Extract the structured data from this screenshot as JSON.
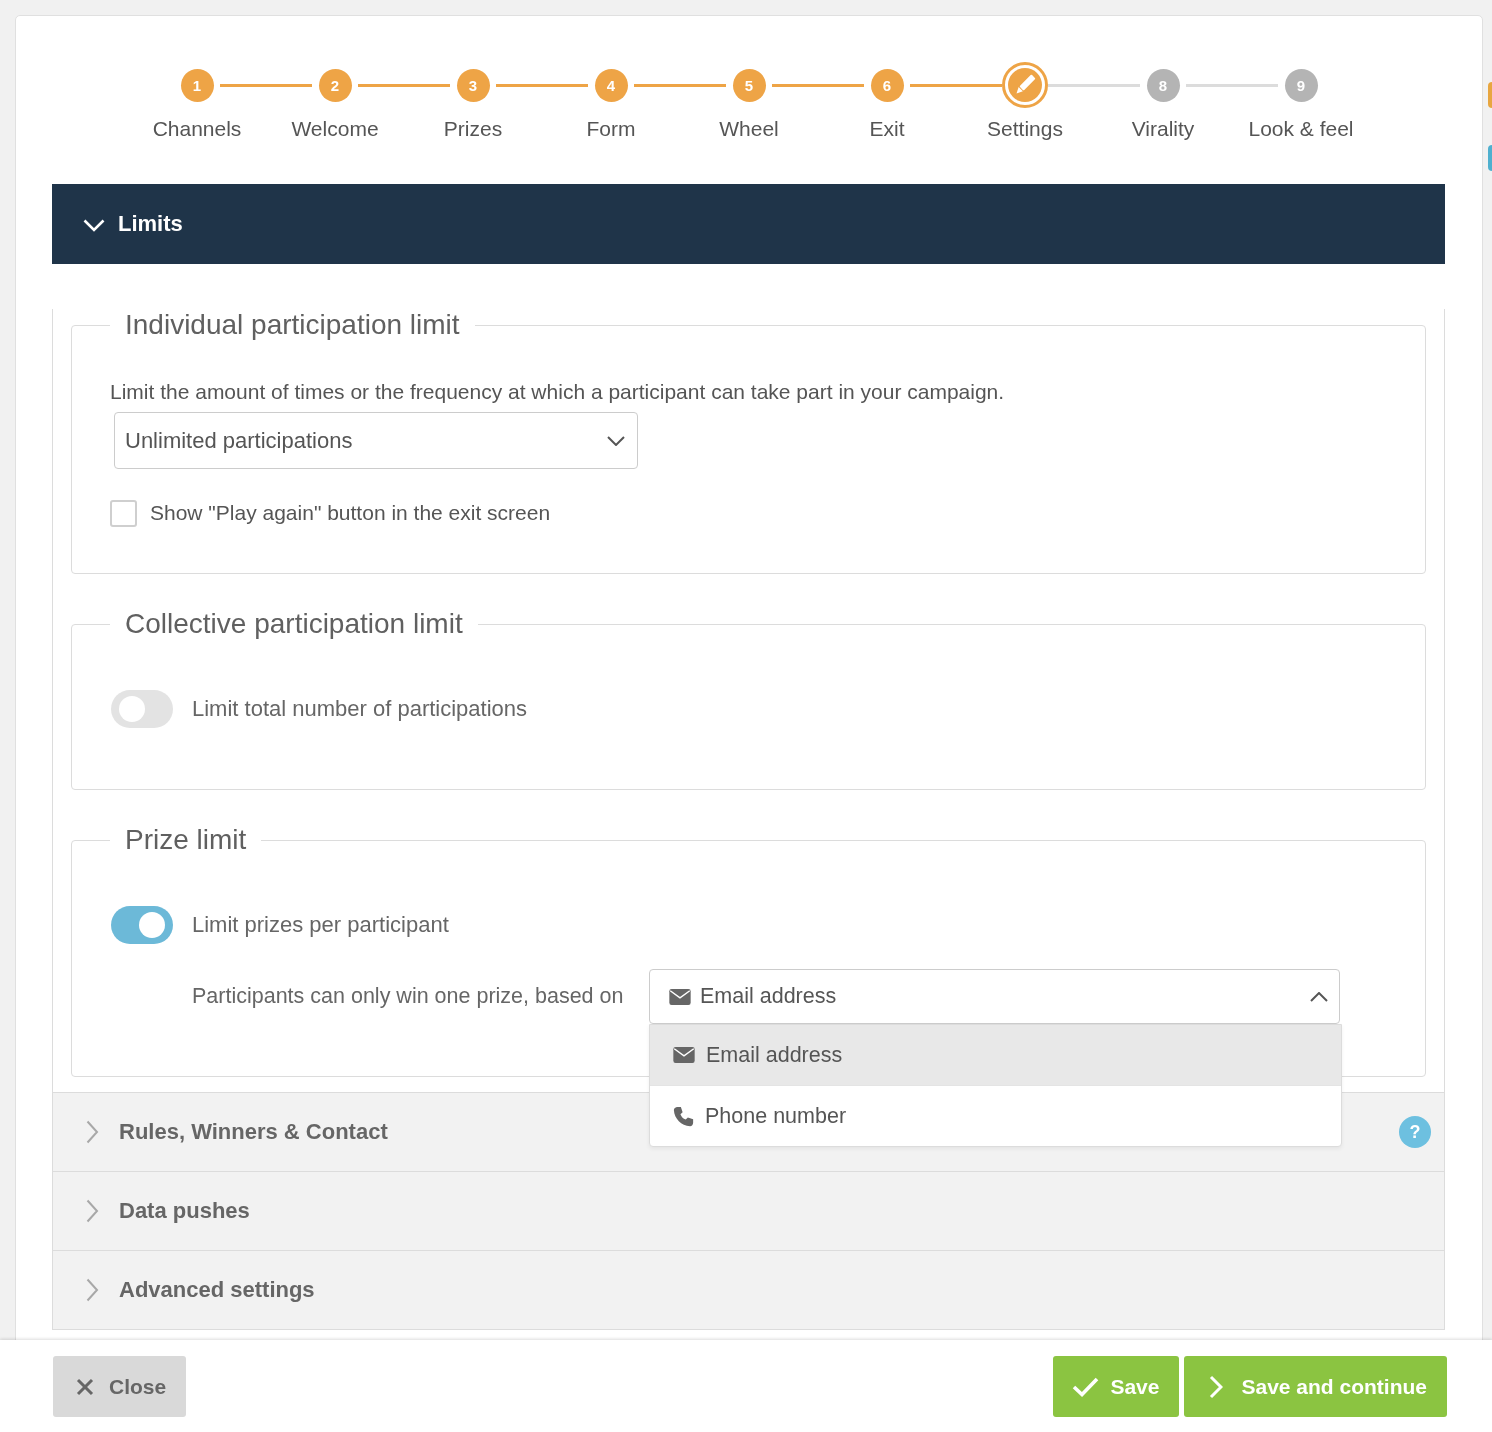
{
  "stepper": {
    "steps": [
      {
        "number": "1",
        "label": "Channels",
        "completed": true,
        "selected": false
      },
      {
        "number": "2",
        "label": "Welcome",
        "completed": true,
        "selected": false
      },
      {
        "number": "3",
        "label": "Prizes",
        "completed": true,
        "selected": false
      },
      {
        "number": "4",
        "label": "Form",
        "completed": true,
        "selected": false
      },
      {
        "number": "5",
        "label": "Wheel",
        "completed": true,
        "selected": false
      },
      {
        "number": "6",
        "label": "Exit",
        "completed": true,
        "selected": false
      },
      {
        "label": "Settings",
        "completed": false,
        "selected": true
      },
      {
        "number": "8",
        "label": "Virality",
        "completed": false,
        "selected": false
      },
      {
        "number": "9",
        "label": "Look & feel",
        "completed": false,
        "selected": false
      }
    ]
  },
  "sections": [
    {
      "title": "Limits",
      "expanded": true,
      "groups": [
        {
          "legend": "Individual participation limit",
          "items": [
            {
              "kind": "text",
              "text": "Limit the amount of times or the frequency at which a participant can take part in your campaign."
            },
            {
              "kind": "select",
              "value": {
                "kind": "plain",
                "text": "Unlimited participations"
              },
              "open": false
            },
            {
              "kind": "checkbox",
              "label": "Show \"Play again\" button in the exit screen",
              "checked": false
            }
          ]
        },
        {
          "legend": "Collective participation limit",
          "items": [
            {
              "kind": "toggle",
              "label": "Limit total number of participations",
              "on": false
            }
          ]
        },
        {
          "legend": "Prize limit",
          "items": [
            {
              "kind": "toggle",
              "label": "Limit prizes per participant",
              "on": true
            },
            {
              "kind": "select",
              "label": "Participants can only win one prize, based on",
              "value": {
                "kind": "email",
                "text": "Email address"
              },
              "open": true,
              "options": [
                {
                  "kind": "email",
                  "label": "Email address",
                  "selected": true
                },
                {
                  "kind": "phone",
                  "label": "Phone number",
                  "selected": false
                }
              ]
            }
          ]
        }
      ]
    },
    {
      "title": "Rules, Winners & Contact",
      "expanded": false,
      "help": "?"
    },
    {
      "title": "Data pushes",
      "expanded": false
    },
    {
      "title": "Advanced settings",
      "expanded": false
    }
  ],
  "footer": {
    "buttons": [
      {
        "kind": "close",
        "label": "Close"
      },
      {
        "kind": "save",
        "label": "Save"
      },
      {
        "kind": "continue",
        "label": "Save and continue"
      }
    ]
  }
}
